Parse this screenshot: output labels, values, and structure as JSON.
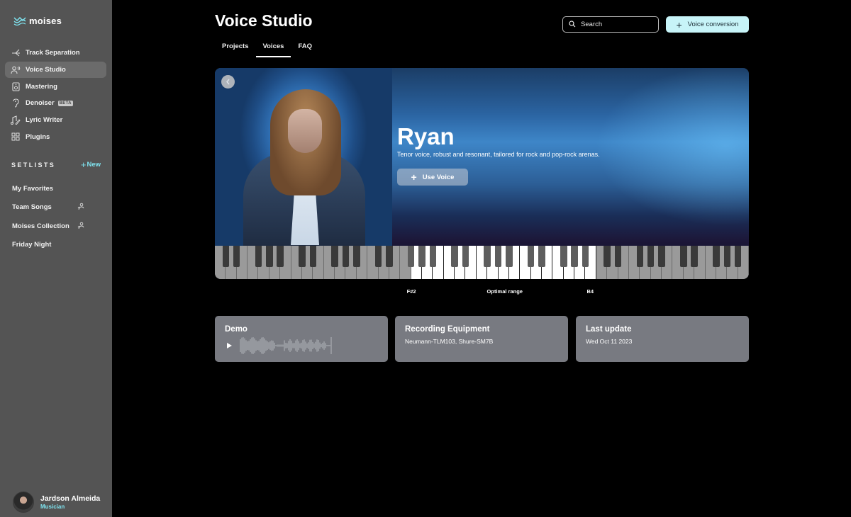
{
  "app": {
    "logo_text": "moises",
    "accent": "#7fe3ef"
  },
  "sidebar": {
    "nav": [
      {
        "label": "Track Separation",
        "icon": "split-icon",
        "active": false
      },
      {
        "label": "Voice Studio",
        "icon": "voice-icon",
        "active": true
      },
      {
        "label": "Mastering",
        "icon": "speaker-icon",
        "active": false
      },
      {
        "label": "Denoiser",
        "icon": "ear-icon",
        "active": false,
        "badge": "BETA"
      },
      {
        "label": "Lyric Writer",
        "icon": "music-pen-icon",
        "active": false
      },
      {
        "label": "Plugins",
        "icon": "grid-icon",
        "active": false
      }
    ],
    "setlists_title": "SETLISTS",
    "new_label": "New",
    "setlists": [
      {
        "label": "My Favorites",
        "shared": false
      },
      {
        "label": "Team Songs",
        "shared": true
      },
      {
        "label": "Moises Collection",
        "shared": true
      },
      {
        "label": "Friday Night",
        "shared": false
      }
    ],
    "user": {
      "name": "Jardson Almeida",
      "role": "Musician"
    }
  },
  "header": {
    "title": "Voice Studio",
    "tabs": [
      {
        "label": "Projects",
        "active": false
      },
      {
        "label": "Voices",
        "active": true
      },
      {
        "label": "FAQ",
        "active": false
      }
    ],
    "search_placeholder": "Search",
    "voice_conversion_label": "Voice conversion"
  },
  "voice": {
    "name": "Ryan",
    "description": "Tenor voice, robust and resonant, tailored for rock and pop-rock arenas.",
    "use_label": "Use Voice",
    "range": {
      "low": "F#2",
      "high": "B4",
      "label": "Optimal range",
      "keyboard_start": "C0",
      "octaves": 7
    }
  },
  "cards": {
    "demo": {
      "title": "Demo"
    },
    "equipment": {
      "title": "Recording Equipment",
      "value": "Neumann-TLM103, Shure-SM7B"
    },
    "last_update": {
      "title": "Last update",
      "value": "Wed Oct 11 2023"
    }
  }
}
